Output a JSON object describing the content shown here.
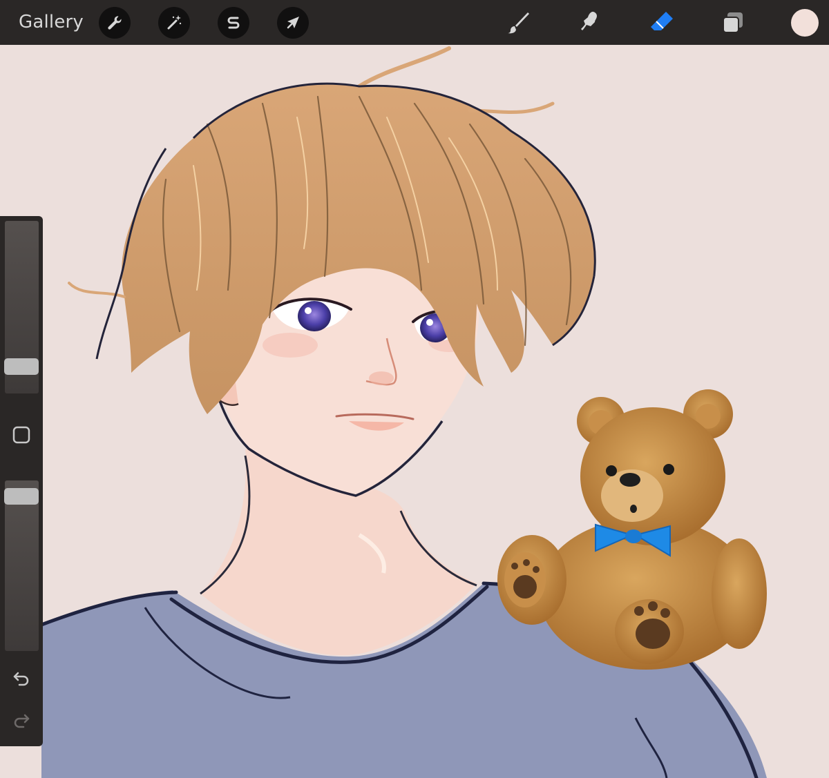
{
  "topbar": {
    "gallery_label": "Gallery",
    "left_tools": [
      {
        "name": "actions",
        "icon": "wrench-icon"
      },
      {
        "name": "adjustments",
        "icon": "magic-wand-icon"
      },
      {
        "name": "selection",
        "icon": "selection-s-icon"
      },
      {
        "name": "transform",
        "icon": "arrow-cursor-icon"
      }
    ],
    "right_tools": [
      {
        "name": "brush",
        "icon": "brush-icon",
        "active": false
      },
      {
        "name": "smudge",
        "icon": "smudge-icon",
        "active": false
      },
      {
        "name": "eraser",
        "icon": "eraser-icon",
        "active": true
      },
      {
        "name": "layers",
        "icon": "layers-icon",
        "active": false
      }
    ],
    "current_color": "#f2e0da"
  },
  "sidebar": {
    "brush_size_level": 0.12,
    "brush_opacity_level": 0.95,
    "modify_button": "square-icon",
    "undo": "undo-icon",
    "redo": "redo-icon"
  },
  "colors": {
    "topbar_bg": "#2a2726",
    "canvas_bg": "#ecdfdc",
    "accent_active": "#1f7ef5",
    "shirt": "#8f97b8",
    "hair": "#d8a676",
    "skin": "#f7dcd3"
  }
}
